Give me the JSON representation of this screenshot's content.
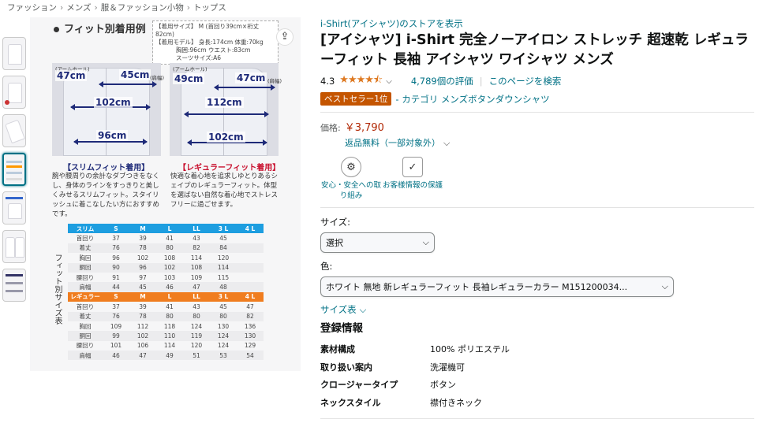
{
  "breadcrumb": [
    "ファッション",
    "メンズ",
    "服＆ファッション小物",
    "トップス"
  ],
  "breadcrumb_sep": "›",
  "image": {
    "fit_title": "フィット別着用例",
    "specs": [
      "【着用サイズ】 M (首回り39cm×裄丈82cm)",
      "【着用モデル】 身長:174cm 体重:70kg",
      "胸囲:96cm ウエスト:83cm",
      "スーツサイズ:A6"
    ],
    "share_icon": "share-icon",
    "slim": {
      "arm_label": "(アームホール)",
      "arm": "47cm",
      "shoulder": "45cm",
      "shoulder_note": "(肩幅)",
      "chest": "102cm",
      "waist": "96cm",
      "name": "【スリムフィット着用】",
      "desc": "腕や腰周りの余計なダブつきをなくし、身体のラインをすっきりと美しくみせるスリムフィット。スタイリッシュに着こなしたい方におすすめです。"
    },
    "regular": {
      "arm_label": "(アームホール)",
      "arm": "49cm",
      "shoulder": "47cm",
      "shoulder_note": "(肩幅)",
      "chest": "112cm",
      "waist": "102cm",
      "name": "【レギュラーフィット着用】",
      "desc": "快適な着心地を追求しゆとりあるシェイプのレギュラーフィット。体型を選ばない自然な着心地でストレスフリーに過ごせます。"
    },
    "table_vertical_label": "フィット別サイズ表",
    "slim_header": [
      "スリム",
      "S",
      "M",
      "L",
      "LL",
      "3 L",
      "4 L"
    ],
    "slim_rows": [
      [
        "首回り",
        "37",
        "39",
        "41",
        "43",
        "45",
        ""
      ],
      [
        "着丈",
        "76",
        "78",
        "80",
        "82",
        "84",
        ""
      ],
      [
        "胸回",
        "96",
        "102",
        "108",
        "114",
        "120",
        ""
      ],
      [
        "胴回",
        "90",
        "96",
        "102",
        "108",
        "114",
        ""
      ],
      [
        "腰回り",
        "91",
        "97",
        "103",
        "109",
        "115",
        ""
      ],
      [
        "肩幅",
        "44",
        "45",
        "46",
        "47",
        "48",
        ""
      ]
    ],
    "regular_header": [
      "レギュラー",
      "S",
      "M",
      "L",
      "LL",
      "3 L",
      "4 L"
    ],
    "regular_rows": [
      [
        "首回り",
        "37",
        "39",
        "41",
        "43",
        "45",
        "47"
      ],
      [
        "着丈",
        "76",
        "78",
        "80",
        "80",
        "80",
        "82"
      ],
      [
        "胸回",
        "109",
        "112",
        "118",
        "124",
        "130",
        "136"
      ],
      [
        "胴回",
        "99",
        "102",
        "110",
        "119",
        "124",
        "130"
      ],
      [
        "腰回り",
        "101",
        "106",
        "114",
        "120",
        "124",
        "129"
      ],
      [
        "肩幅",
        "46",
        "47",
        "49",
        "51",
        "53",
        "54"
      ]
    ]
  },
  "product": {
    "store_link": "i-Shirt(アイシャツ)のストアを表示",
    "title": "[アイシャツ] i-Shirt 完全ノーアイロン ストレッチ 超速乾 レギュラーフィット 長袖 アイシャツ ワイシャツ メンズ",
    "rating": "4.3",
    "stars": "★★★★⯪",
    "reviews": "4,789個の評価",
    "search_page": "このページを検索",
    "bestseller": "ベストセラー1位",
    "category": "- カテゴリ メンズボタンダウンシャツ",
    "price_label": "価格:",
    "price": "￥3,790",
    "returns": "返品無料（一部対象外）",
    "badges": [
      {
        "icon": "safety-badge-icon",
        "glyph": "⚙",
        "label": "安心・安全への取り組み"
      },
      {
        "icon": "secure-bag-icon",
        "glyph": "✓",
        "label": "お客様情報の保護"
      }
    ],
    "size_label": "サイズ:",
    "size_value": "選択",
    "color_label": "色:",
    "color_value": "ホワイト 無地 新レギュラーフィット 長袖レギュラーカラー M151200034...",
    "size_chart_link": "サイズ表",
    "info_heading": "登録情報",
    "info": [
      {
        "k": "素材構成",
        "v": "100% ポリエステル"
      },
      {
        "k": "取り扱い案内",
        "v": "洗濯機可"
      },
      {
        "k": "クロージャータイプ",
        "v": "ボタン"
      },
      {
        "k": "ネックスタイル",
        "v": "襟付きネック"
      }
    ]
  }
}
